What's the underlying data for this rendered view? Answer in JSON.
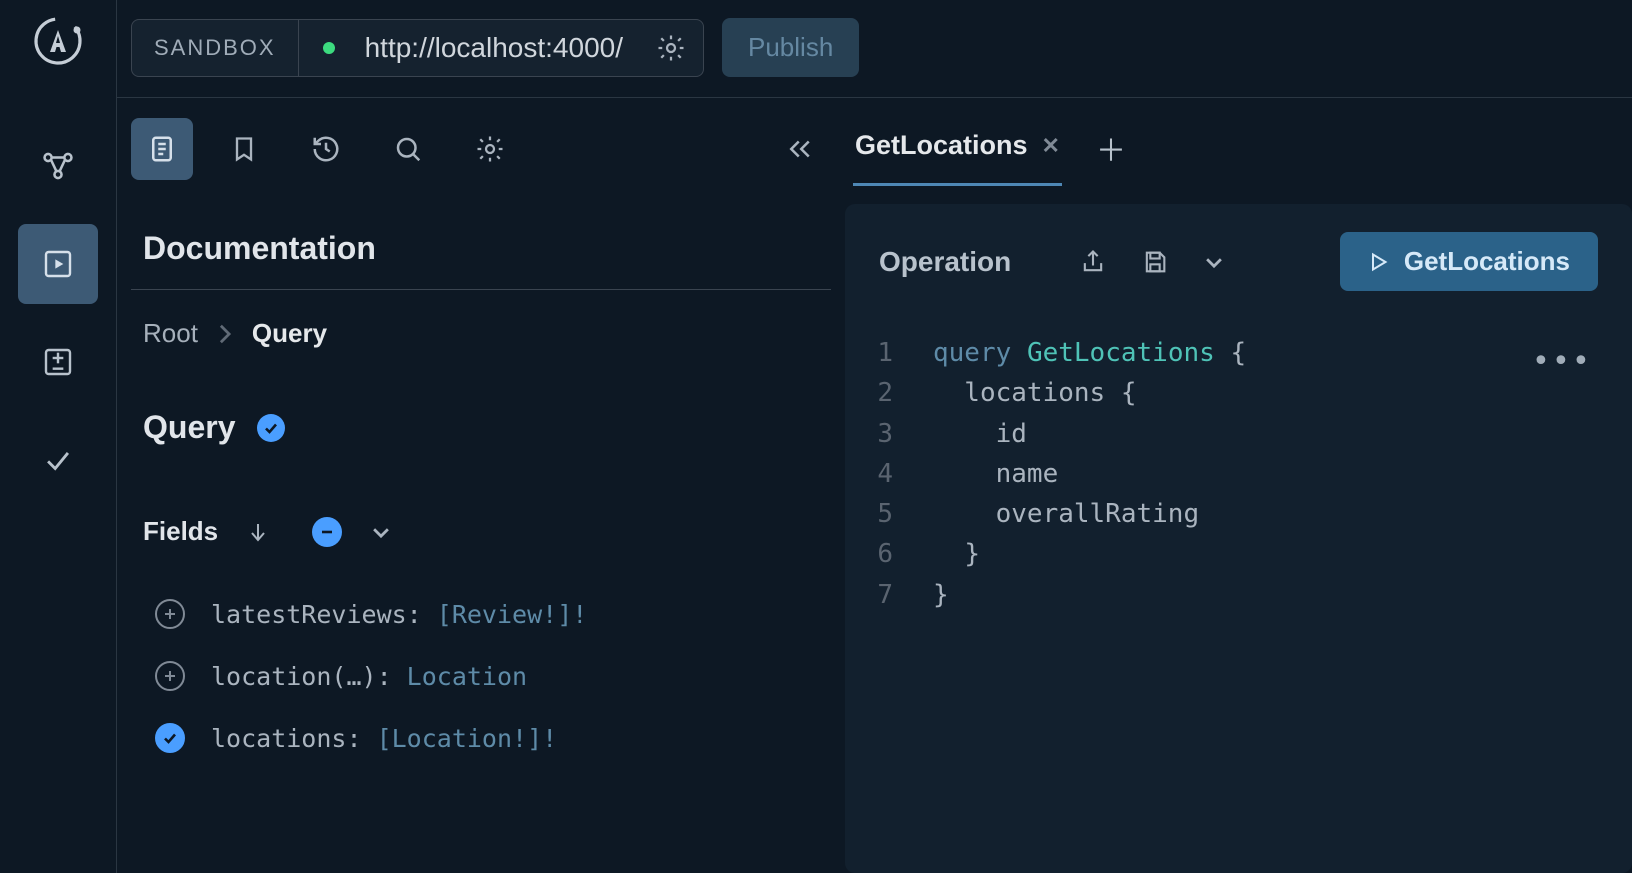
{
  "topbar": {
    "sandbox_label": "SANDBOX",
    "url": "http://localhost:4000/",
    "publish_label": "Publish"
  },
  "rail": {
    "icons": [
      "graph-icon",
      "play-box-icon",
      "diff-icon",
      "check-icon"
    ],
    "active": "play-box-icon"
  },
  "panel_toolbar": {
    "icons": [
      "doc-icon",
      "bookmark-icon",
      "history-icon",
      "search-icon",
      "gear-icon",
      "collapse-icon"
    ],
    "active": "doc-icon"
  },
  "documentation": {
    "title": "Documentation",
    "breadcrumb": [
      "Root",
      "Query"
    ],
    "type_name": "Query",
    "fields_label": "Fields",
    "fields": [
      {
        "name": "latestReviews",
        "args": "",
        "type": "[Review!]!",
        "selected": false
      },
      {
        "name": "location",
        "args": "(…)",
        "type": "Location",
        "selected": false
      },
      {
        "name": "locations",
        "args": "",
        "type": "[Location!]!",
        "selected": true
      }
    ]
  },
  "tabs": [
    {
      "label": "GetLocations",
      "active": true
    }
  ],
  "operation": {
    "title": "Operation",
    "run_label": "GetLocations",
    "code": {
      "lines": [
        {
          "n": 1,
          "html": [
            {
              "t": "kw",
              "v": "query"
            },
            {
              "t": "sp",
              "v": " "
            },
            {
              "t": "opname",
              "v": "GetLocations"
            },
            {
              "t": "sp",
              "v": " "
            },
            {
              "t": "brace",
              "v": "{"
            }
          ],
          "indent": 0
        },
        {
          "n": 2,
          "html": [
            {
              "t": "plain",
              "v": "locations "
            },
            {
              "t": "brace",
              "v": "{"
            }
          ],
          "indent": 1
        },
        {
          "n": 3,
          "html": [
            {
              "t": "plain",
              "v": "id"
            }
          ],
          "indent": 2
        },
        {
          "n": 4,
          "html": [
            {
              "t": "plain",
              "v": "name"
            }
          ],
          "indent": 2
        },
        {
          "n": 5,
          "html": [
            {
              "t": "plain",
              "v": "overallRating"
            }
          ],
          "indent": 2
        },
        {
          "n": 6,
          "html": [
            {
              "t": "brace",
              "v": "}"
            }
          ],
          "indent": 1
        },
        {
          "n": 7,
          "html": [
            {
              "t": "brace",
              "v": "}"
            }
          ],
          "indent": 0
        }
      ]
    }
  },
  "colors": {
    "accent": "#4a9eff",
    "run": "#2b6289",
    "kw": "#5e8ba8",
    "opname": "#4fc3b7"
  }
}
